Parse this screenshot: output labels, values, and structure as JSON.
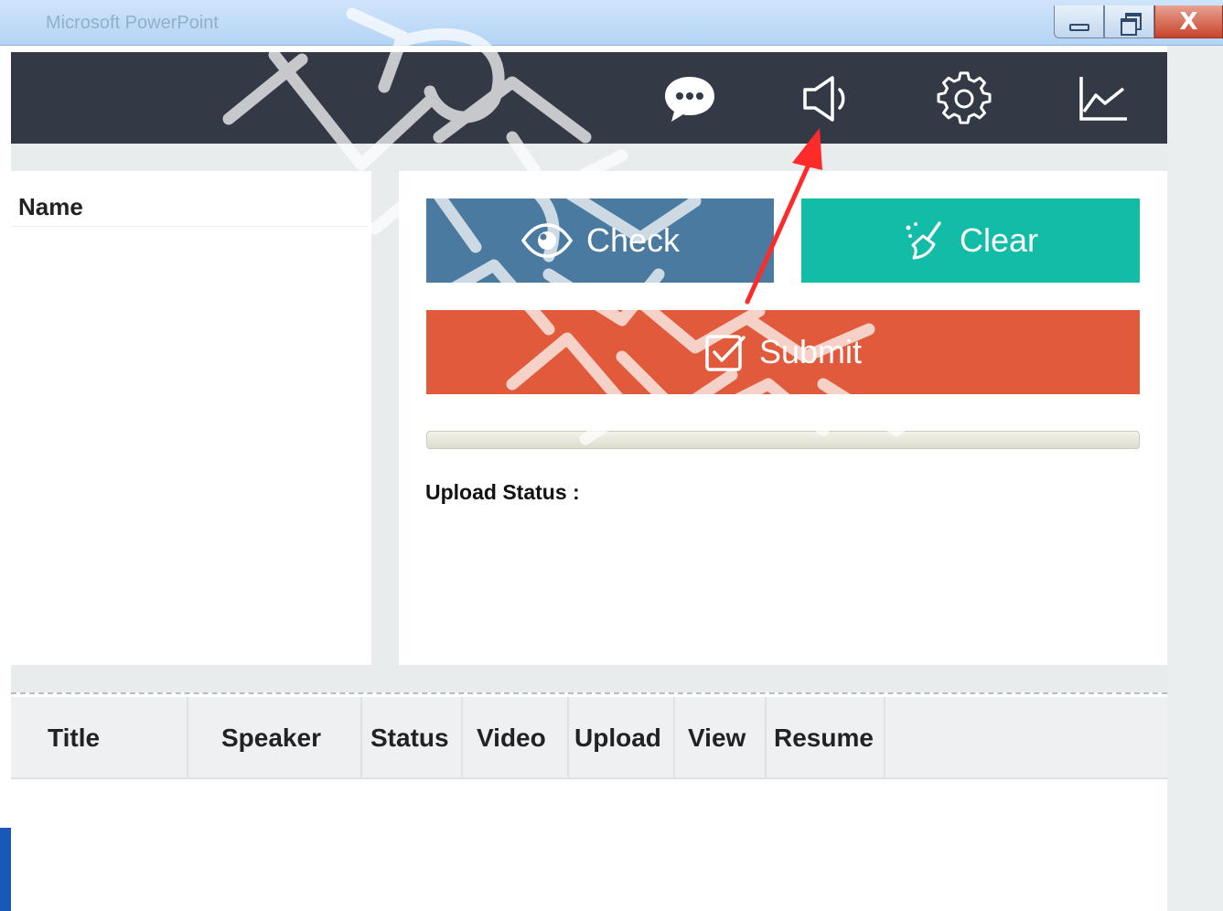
{
  "window": {
    "title": "Microsoft PowerPoint",
    "close_glyph": "X"
  },
  "toolbar": {
    "icons": [
      "chat-bubble-icon",
      "speaker-icon",
      "gear-icon",
      "line-chart-icon"
    ]
  },
  "name_panel": {
    "header": "Name"
  },
  "controls": {
    "check_label": "Check",
    "clear_label": "Clear",
    "submit_label": "Submit",
    "upload_progress": 0,
    "upload_status_label": "Upload Status :"
  },
  "table": {
    "columns": [
      "Title",
      "Speaker",
      "Status",
      "Video",
      "Upload",
      "View",
      "Resume"
    ]
  },
  "colors": {
    "toolbar_bg": "#333a46",
    "check": "#4b7aa1",
    "clear": "#12bca6",
    "submit": "#e15a3b",
    "annotation_arrow": "#ff2a2a"
  }
}
